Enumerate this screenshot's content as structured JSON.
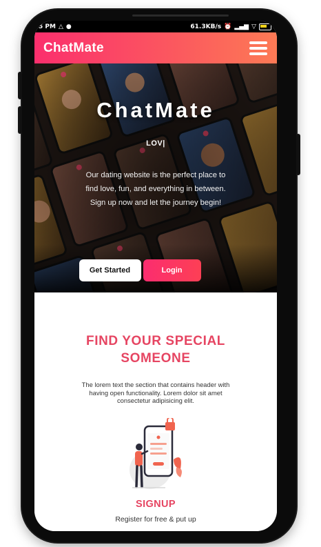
{
  "status_bar": {
    "time": "5 PM",
    "net_speed": "61.3KB/s"
  },
  "navbar": {
    "brand": "ChatMate",
    "menu_icon": "hamburger-menu-icon"
  },
  "hero": {
    "title": "ChatMate",
    "typed_text": "LOV|",
    "description": "Our dating website is the perfect place to find love, fun, and everything in between. Sign up now and let the journey begin!",
    "primary_button": "Get Started",
    "secondary_button": "Login"
  },
  "section": {
    "title": "FIND YOUR SPECIAL SOMEONE",
    "text": "The lorem text the section that contains header with having open functionality. Lorem dolor sit amet consectetur adipisicing elit.",
    "subtitle": "SIGNUP",
    "subtext": "Register for free & put up"
  },
  "colors": {
    "accent": "#fb2f6d",
    "accent_secondary": "#fd7a55",
    "heading": "#e64562"
  }
}
